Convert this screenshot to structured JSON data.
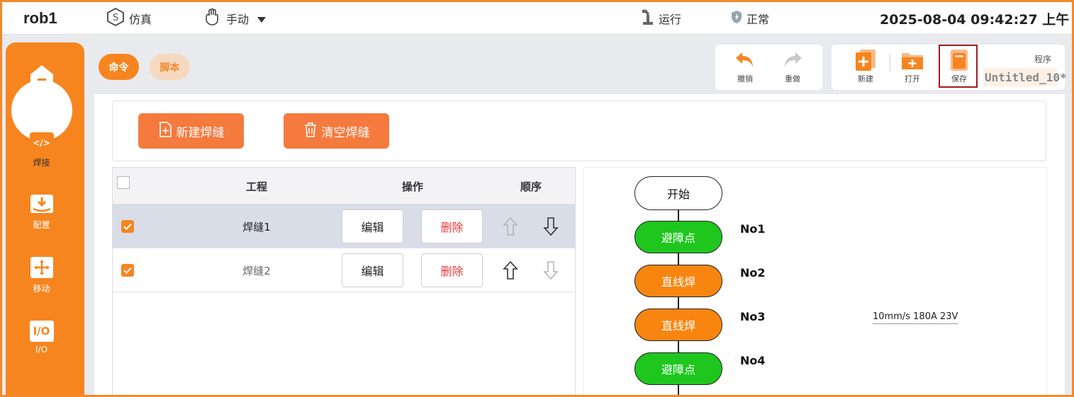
{
  "topbar": {
    "robot_name": "rob1",
    "sim_label": "仿真",
    "sim_icon": "S",
    "manual_label": "手动",
    "run_label": "运行",
    "normal_label": "正常",
    "datetime": "2025-08-04 09:42:27 上午"
  },
  "sidebar": {
    "items": [
      {
        "label": "主页",
        "icon": "home-icon"
      },
      {
        "label": "焊接",
        "icon": "code-icon",
        "glyph": "</>"
      },
      {
        "label": "配置",
        "icon": "download-config-icon"
      },
      {
        "label": "移动",
        "icon": "move-arrows-icon"
      },
      {
        "label": "I/O",
        "icon": "io-icon",
        "glyph": "I/O"
      }
    ]
  },
  "modes": {
    "command": "命令",
    "script": "脚本"
  },
  "toolbar": {
    "undo": "撤销",
    "redo": "重做",
    "new": "新建",
    "open": "打开",
    "save": "保存",
    "program_label": "程序",
    "program_name": "Untitled_10*"
  },
  "actions": {
    "new_seam": "新建焊缝",
    "clear_seam": "清空焊缝"
  },
  "table": {
    "headers": {
      "project": "工程",
      "operation": "操作",
      "order": "顺序"
    },
    "rows": [
      {
        "name": "焊缝1",
        "edit": "编辑",
        "delete": "删除",
        "checked": true,
        "selected": true
      },
      {
        "name": "焊缝2",
        "edit": "编辑",
        "delete": "删除",
        "checked": true,
        "selected": false
      }
    ]
  },
  "flow": {
    "start": "开始",
    "nodes": [
      {
        "label": "避障点",
        "no": "No1",
        "color": "#1ec61e"
      },
      {
        "label": "直线焊",
        "no": "No2",
        "color": "#f7850f"
      },
      {
        "label": "直线焊",
        "no": "No3",
        "color": "#f7850f"
      },
      {
        "label": "避障点",
        "no": "No4",
        "color": "#1ec61e"
      }
    ],
    "param_text": "10mm/s 180A 23V"
  },
  "colors": {
    "accent": "#f7851f",
    "danger": "#e53a3a",
    "highlight_border": "#a31a1f"
  }
}
